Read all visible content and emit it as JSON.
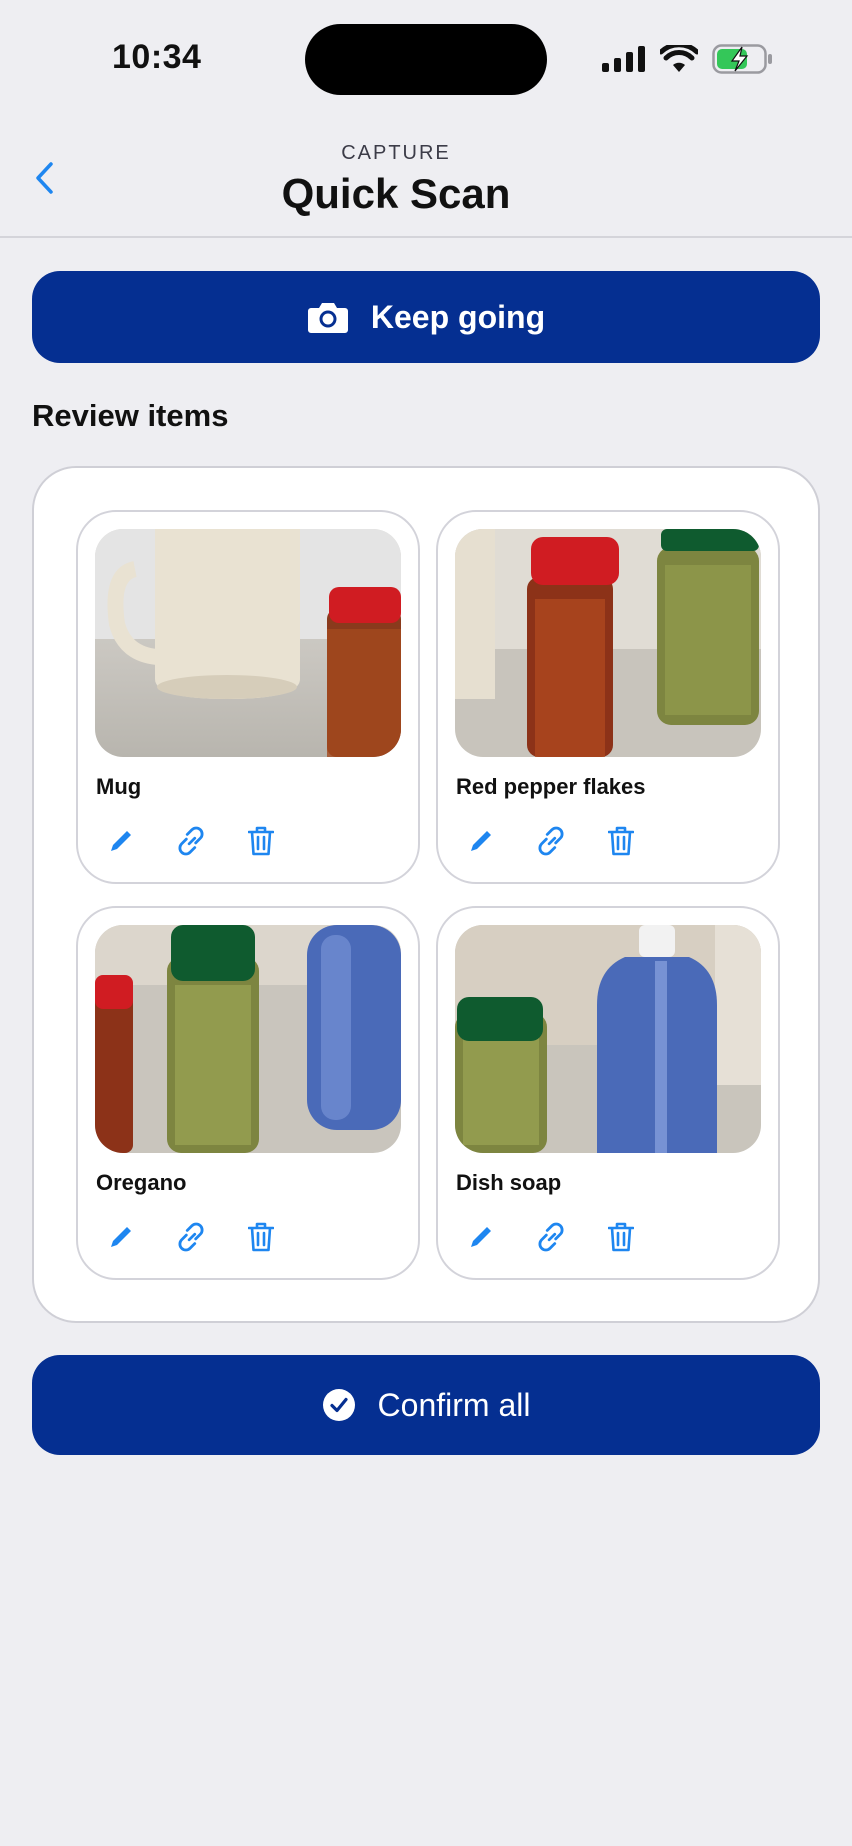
{
  "status_bar": {
    "time": "10:34"
  },
  "header": {
    "eyebrow": "CAPTURE",
    "title": "Quick Scan",
    "back_icon": "chevron-left-icon"
  },
  "keep_going_button": {
    "label": "Keep going",
    "icon": "camera-icon"
  },
  "review": {
    "title": "Review items",
    "items": [
      {
        "name": "Mug",
        "photo": "mug-and-pepper-flakes"
      },
      {
        "name": "Red pepper flakes",
        "photo": "pepper-flakes-and-oregano"
      },
      {
        "name": "Oregano",
        "photo": "oregano-and-blue-bottle"
      },
      {
        "name": "Dish soap",
        "photo": "oregano-and-soap-bottle"
      }
    ],
    "actions": [
      "pencil-icon",
      "link-icon",
      "trash-icon"
    ]
  },
  "confirm_button": {
    "label": "Confirm all",
    "icon": "check-circle-icon"
  },
  "colors": {
    "primary": "#052F91",
    "accent": "#1E86F0",
    "background": "#EEEEF2",
    "battery_green": "#34C759"
  }
}
